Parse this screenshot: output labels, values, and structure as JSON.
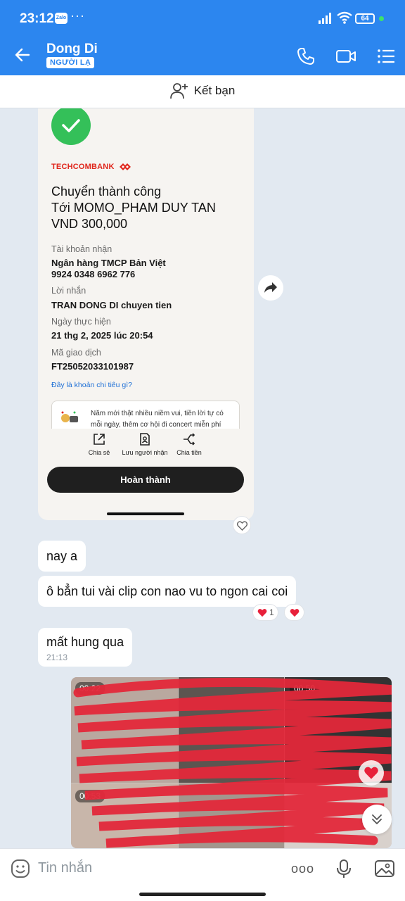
{
  "status_bar": {
    "time": "23:12",
    "zalo_icon": "Zalo",
    "more": "···",
    "battery": "64"
  },
  "header": {
    "contact_name": "Dong Di",
    "badge": "NGƯỜI LẠ"
  },
  "friend_bar": {
    "label": "Kết bạn"
  },
  "transfer_receipt": {
    "bank": "TECHCOMBANK",
    "title_line1": "Chuyển thành công",
    "title_line2": "Tới MOMO_PHAM DUY TAN",
    "amount": "VND 300,000",
    "account_label": "Tài khoản nhận",
    "account_bank": "Ngân hàng TMCP Bản Việt",
    "account_number": "9924 0348 6962 776",
    "message_label": "Lời nhắn",
    "message_value": "TRAN DONG DI chuyen tien",
    "date_label": "Ngày thực hiện",
    "date_value": "21 thg 2, 2025 lúc 20:54",
    "code_label": "Mã giao dịch",
    "code_value": "FT25052033101987",
    "spend_link": "Đây là khoản chi tiêu gì?",
    "promo_text": "Năm mới thật nhiều niềm vui, tiền lời tự có mỗi ngày, thêm cơ hội đi concert miễn phí",
    "actions": {
      "share": "Chia sẻ",
      "save_recipient": "Lưu người nhận",
      "split": "Chia tiền"
    },
    "done_button": "Hoàn thành"
  },
  "messages": [
    {
      "text": "nay a"
    },
    {
      "text": "ô bẳn tui vài clip con nao vu to ngon cai coi",
      "reaction_count": "1"
    },
    {
      "text": "mất hung qua",
      "time": "21:13"
    }
  ],
  "videos": [
    {
      "duration": "00:22"
    },
    {
      "duration": "00:50"
    },
    {
      "duration": "00:53"
    }
  ],
  "input_bar": {
    "placeholder": "Tin nhắn",
    "more": "ooo"
  },
  "colors": {
    "brand_blue": "#2c86ef",
    "heart_red": "#e8203a",
    "success_green": "#34c059",
    "scribble_red": "#e3283a"
  },
  "icons": [
    "back-arrow-icon",
    "phone-icon",
    "video-call-icon",
    "menu-list-icon",
    "add-friend-icon",
    "share-forward-icon",
    "heart-icon",
    "emoji-icon",
    "mic-icon",
    "image-icon",
    "chevron-double-down-icon"
  ]
}
